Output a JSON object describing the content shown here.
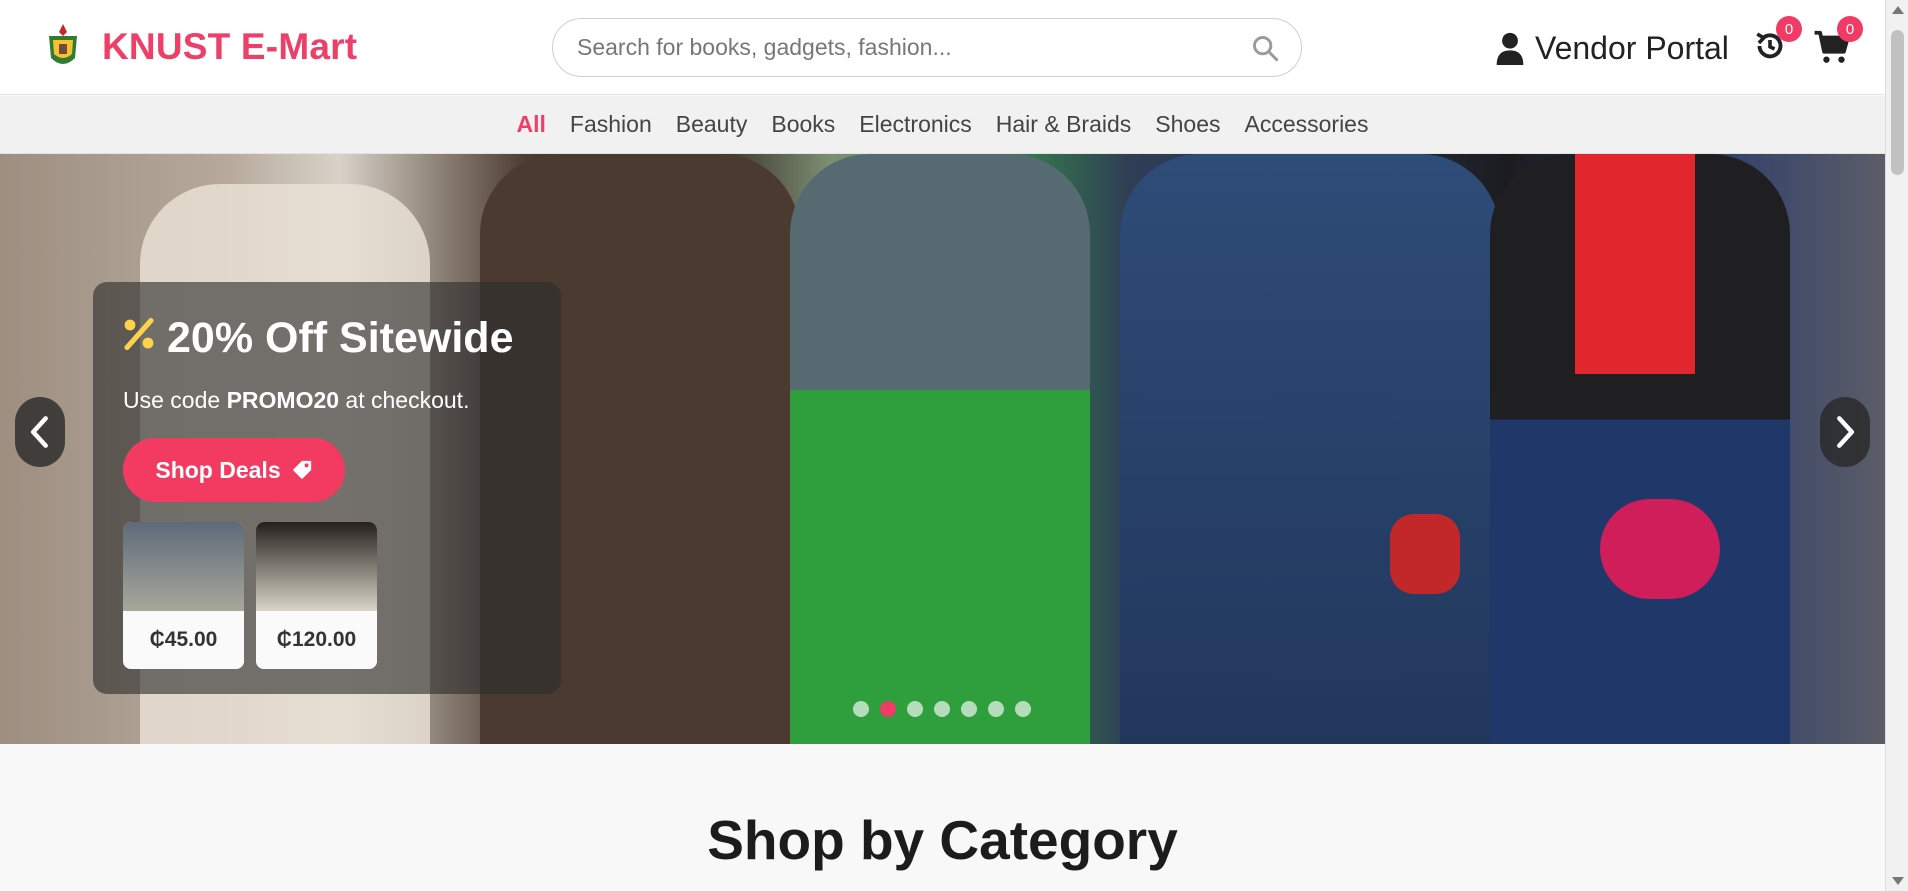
{
  "header": {
    "brand": "KNUST E-Mart",
    "logo_icon": "knust-crest-icon",
    "search": {
      "placeholder": "Search for books, gadgets, fashion...",
      "value": ""
    },
    "vendor_label": "Vendor Portal",
    "history_count": "0",
    "cart_count": "0"
  },
  "nav": {
    "categories": [
      "All",
      "Fashion",
      "Beauty",
      "Books",
      "Electronics",
      "Hair & Braids",
      "Shoes",
      "Accessories"
    ],
    "active": "All"
  },
  "hero": {
    "title": "20% Off Sitewide",
    "subtitle_prefix": "Use code ",
    "promo_code": "PROMO20",
    "subtitle_suffix": " at checkout.",
    "cta_label": "Shop Deals",
    "products": [
      {
        "price": "₵45.00"
      },
      {
        "price": "₵120.00"
      }
    ],
    "slide_count": 7,
    "active_slide": 2
  },
  "section": {
    "title": "Shop by Category"
  },
  "colors": {
    "accent": "#ee3f68",
    "promo_icon": "#ffd24c",
    "badge": "#f23a66"
  }
}
